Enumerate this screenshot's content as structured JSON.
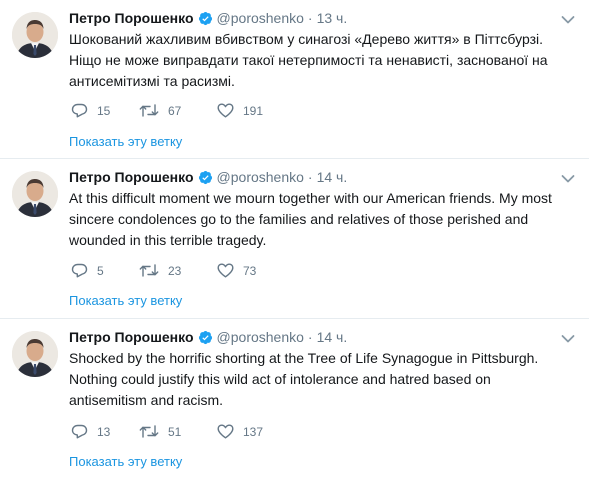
{
  "tweets": [
    {
      "name": "Петро Порошенко",
      "handle": "@poroshenko",
      "separator": "·",
      "time": "13 ч.",
      "text": "Шокований жахливим вбивством у синагозі «Дерево життя» в Піттсбурзі. Ніщо не може виправдати такої нетерпимості та ненависті, заснованої на антисемітизмі та расизмі.",
      "replies": "15",
      "retweets": "67",
      "likes": "191",
      "thread_link": "Показать эту ветку"
    },
    {
      "name": "Петро Порошенко",
      "handle": "@poroshenko",
      "separator": "·",
      "time": "14 ч.",
      "text": "At this difficult moment we mourn together with our American friends. My most sincere condolences go to the families and relatives of those perished and wounded in this terrible tragedy.",
      "replies": "5",
      "retweets": "23",
      "likes": "73",
      "thread_link": "Показать эту ветку"
    },
    {
      "name": "Петро Порошенко",
      "handle": "@poroshenko",
      "separator": "·",
      "time": "14 ч.",
      "text": "Shocked by the horrific shorting at the Tree of Life Synagogue in  Pittsburgh. Nothing could justify this wild act of intolerance and hatred based on antisemitism and racism.",
      "replies": "13",
      "retweets": "51",
      "likes": "137",
      "thread_link": "Показать эту ветку"
    }
  ],
  "icons": {
    "verified": "verified-badge-icon",
    "reply": "reply-icon",
    "retweet": "retweet-icon",
    "like": "heart-icon",
    "caret": "chevron-down-icon"
  },
  "colors": {
    "link": "#1b95e0",
    "verified": "#1da1f2",
    "muted": "#657786",
    "divider": "#e6ecf0"
  }
}
